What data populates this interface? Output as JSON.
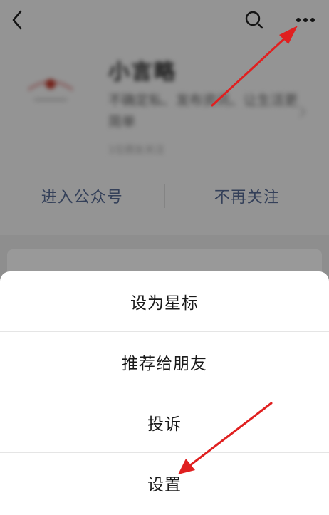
{
  "nav": {
    "back_icon": "chevron-left-icon",
    "search_icon": "search-icon",
    "more_icon": "more-dots-icon"
  },
  "profile": {
    "name": "小言略",
    "description": "不确定私、发布资讯、让生活更简单",
    "meta": "1位朋友关注",
    "avatar_icon": "account-avatar-icon"
  },
  "actions": {
    "enter_label": "进入公众号",
    "unfollow_label": "不再关注"
  },
  "sheet": {
    "items": [
      {
        "label": "设为星标"
      },
      {
        "label": "推荐给朋友"
      },
      {
        "label": "投诉"
      },
      {
        "label": "设置"
      }
    ]
  },
  "colors": {
    "link_blue": "#576b95",
    "annotation_red": "#e02020",
    "overlay": "rgba(0,0,0,0.40)"
  }
}
